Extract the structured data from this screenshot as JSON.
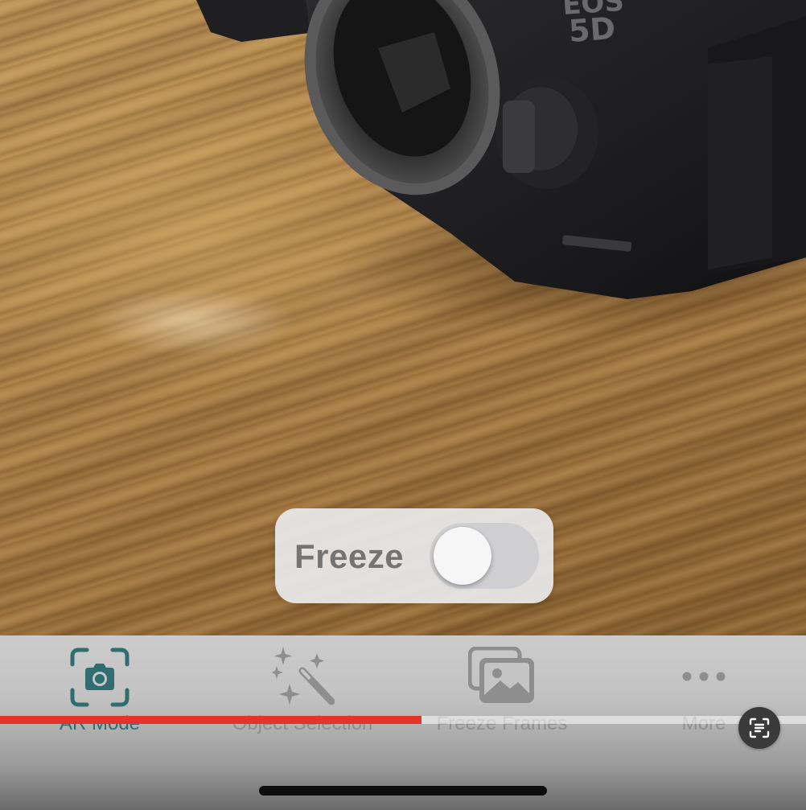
{
  "toggle": {
    "label": "Freeze",
    "on": false
  },
  "tabs": [
    {
      "label": "AR Mode",
      "icon": "camera-icon",
      "active": true
    },
    {
      "label": "Object Selection",
      "icon": "magic-wand-icon",
      "active": false
    },
    {
      "label": "Freeze Frames",
      "icon": "photo-stack-icon",
      "active": false
    },
    {
      "label": "More",
      "icon": "ellipsis-icon",
      "active": false
    }
  ],
  "video_progress": 0.523,
  "overlay_button_icon": "lens-scan-icon",
  "camera_body_text": "EOS 5D",
  "colors": {
    "accent": "#2f6d70",
    "progress": "#e5322a",
    "inactive": "#8e8e8e"
  }
}
